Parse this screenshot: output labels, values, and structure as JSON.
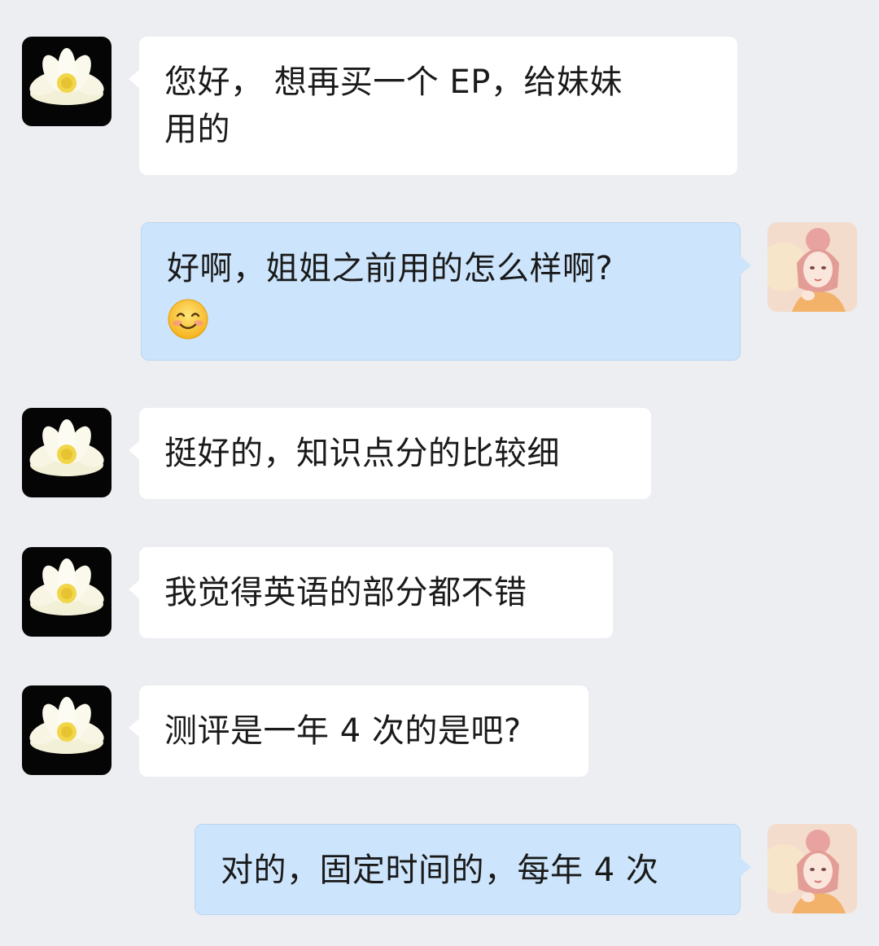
{
  "messages": [
    {
      "side": "left",
      "avatar": "lotus-avatar",
      "lines": [
        "您好，  想再买一个 EP，给妹妹",
        "用的"
      ]
    },
    {
      "side": "right",
      "avatar": "girl-avatar",
      "lines": [
        "好啊，姐姐之前用的怎么样啊?"
      ],
      "emoji": "smiling-face-emoji"
    },
    {
      "side": "left",
      "avatar": "lotus-avatar",
      "lines": [
        "挺好的，知识点分的比较细"
      ]
    },
    {
      "side": "left",
      "avatar": "lotus-avatar",
      "lines": [
        "我觉得英语的部分都不错"
      ]
    },
    {
      "side": "left",
      "avatar": "lotus-avatar",
      "lines": [
        "测评是一年 4 次的是吧?"
      ]
    },
    {
      "side": "right",
      "avatar": "girl-avatar",
      "lines": [
        "对的，固定时间的，每年 4 次"
      ]
    }
  ],
  "colors": {
    "background": "#edeef2",
    "incoming_bubble": "#ffffff",
    "outgoing_bubble": "#cde5fc"
  }
}
